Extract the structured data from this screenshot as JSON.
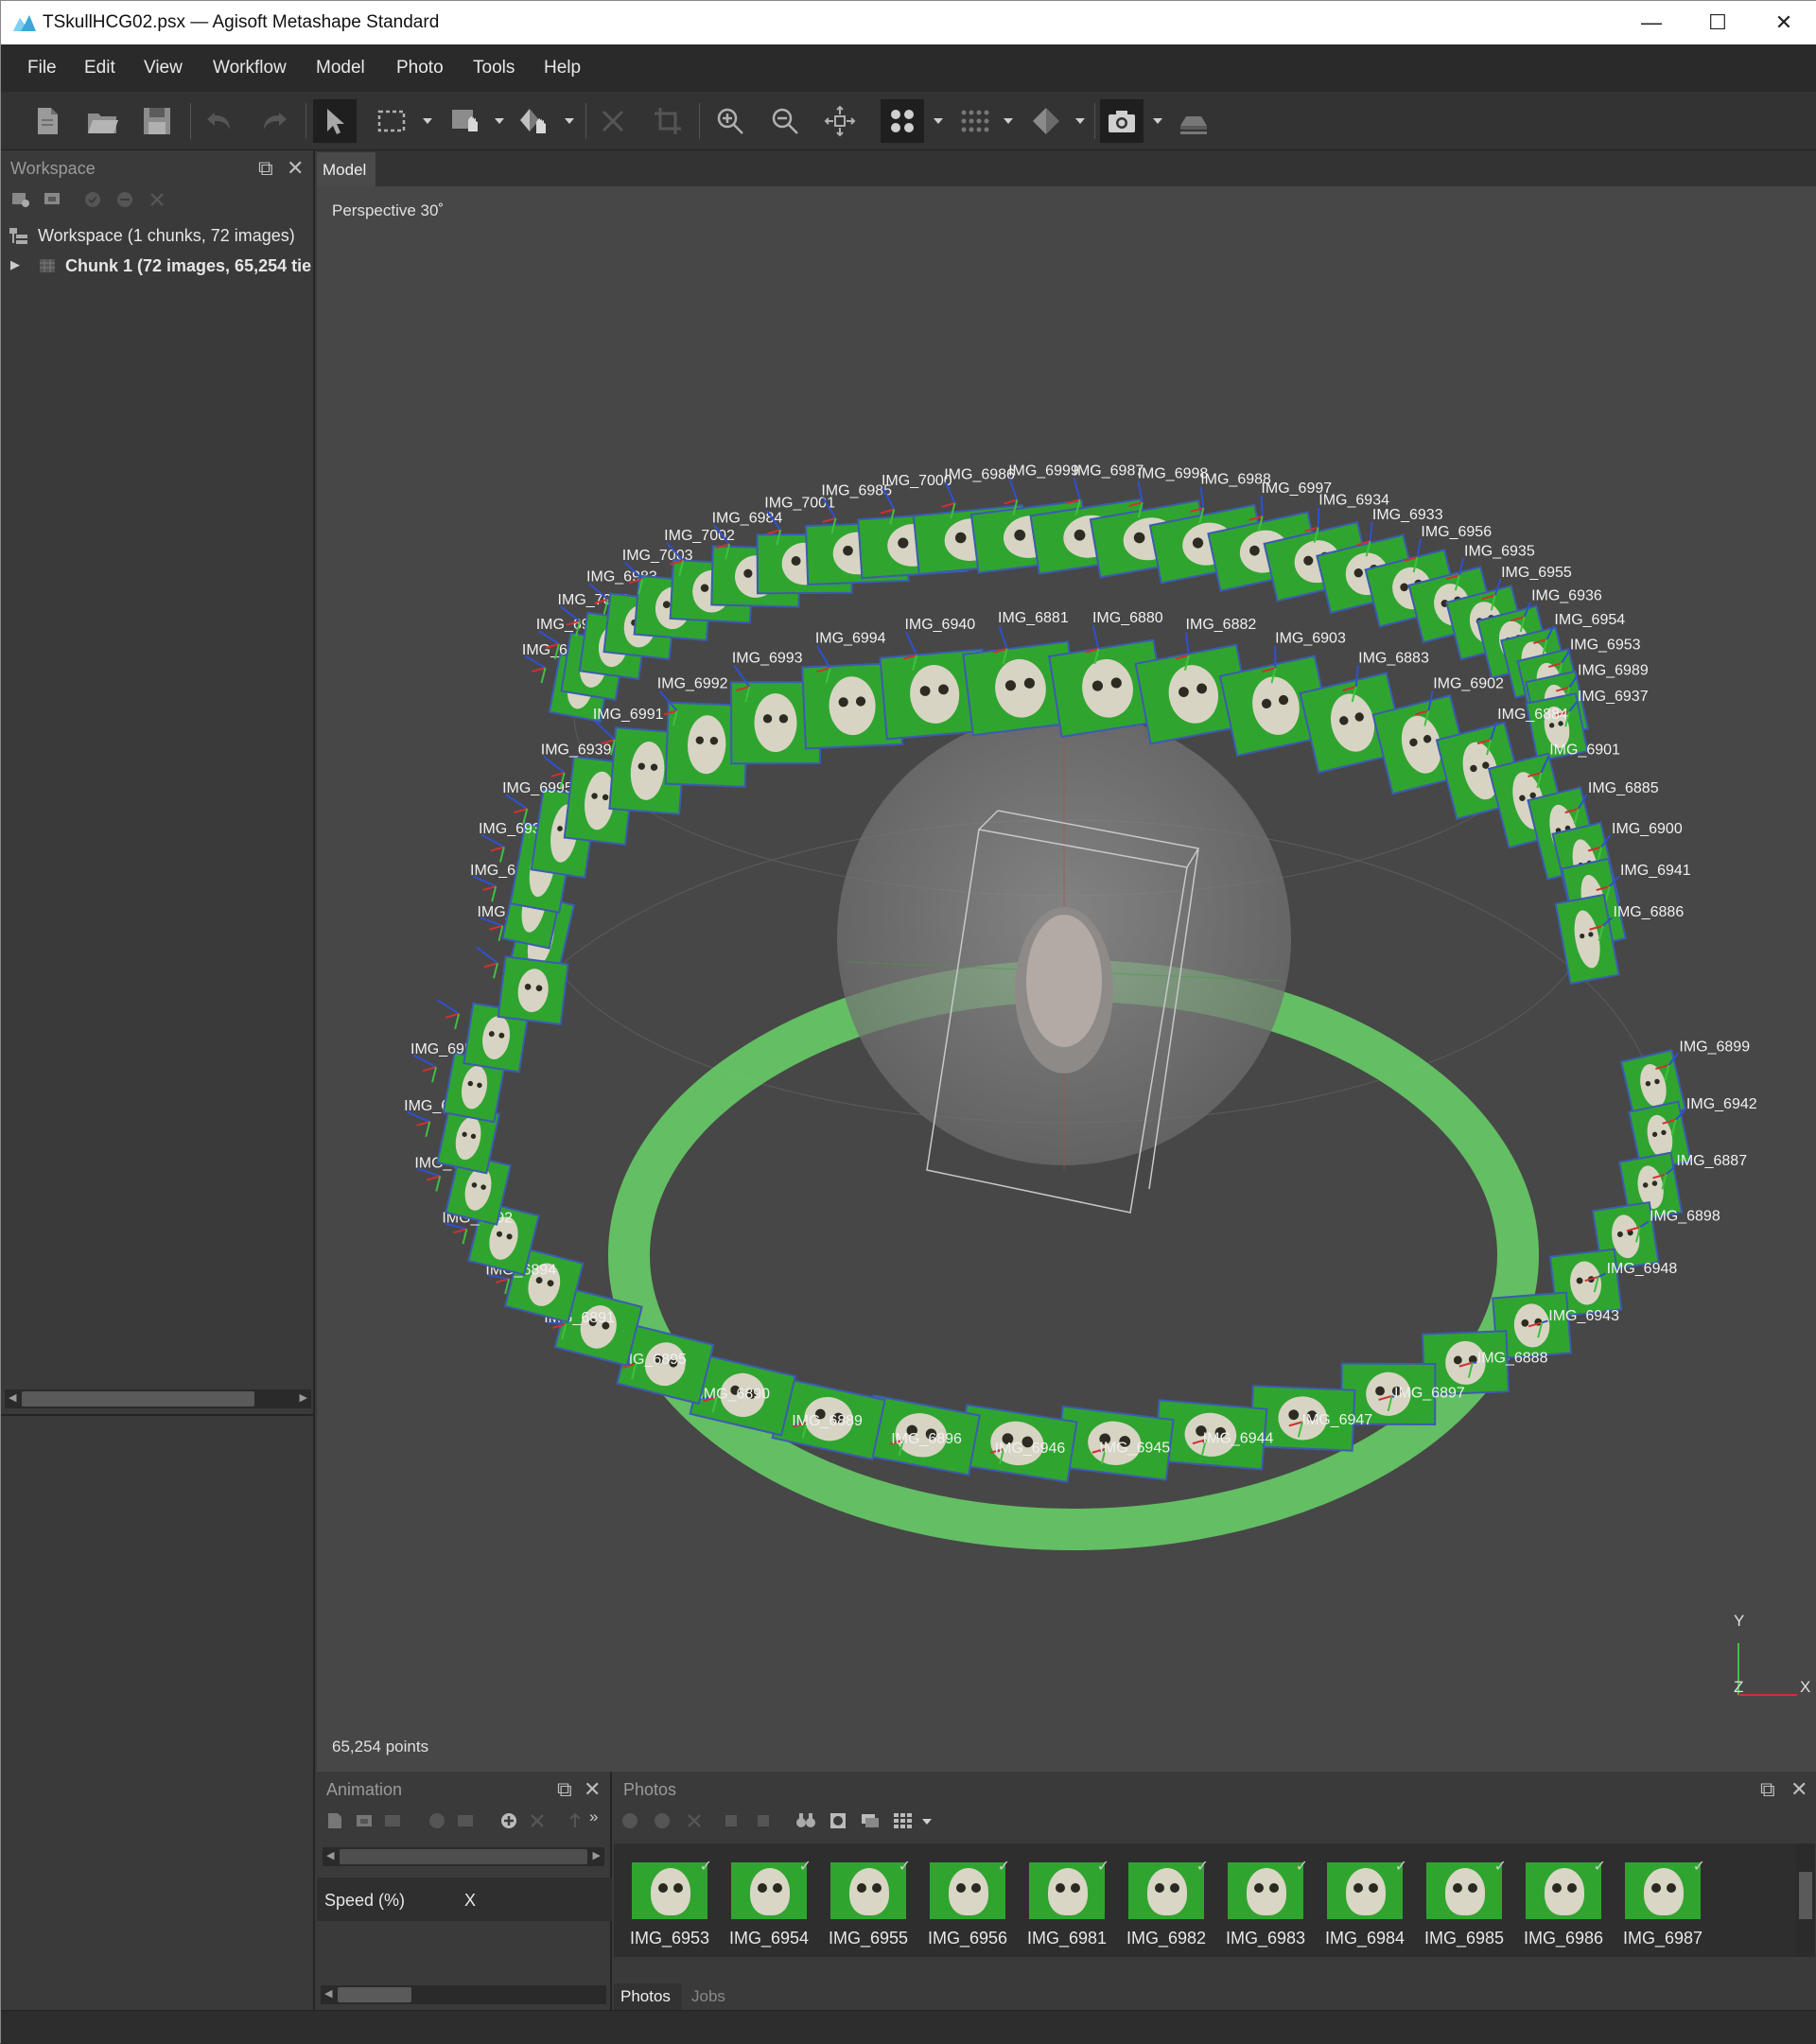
{
  "window": {
    "title": "TSkullHCG02.psx — Agisoft Metashape Standard",
    "minimize": "—",
    "maximize": "☐",
    "close": "✕"
  },
  "menu": [
    "File",
    "Edit",
    "View",
    "Workflow",
    "Model",
    "Photo",
    "Tools",
    "Help"
  ],
  "workspace": {
    "header": "Workspace",
    "root": "Workspace (1 chunks, 72 images)",
    "chunk": "Chunk 1 (72 images, 65,254 tie p"
  },
  "model": {
    "tab": "Model",
    "projection": "Perspective 30˚",
    "points": "65,254 points",
    "axis_y": "Y",
    "axis_z": "Z",
    "axis_x": "X",
    "camera_labels": [
      "IMG_6982",
      "IMG_6981",
      "IMG_7004",
      "IMG_6983",
      "IMG_7003",
      "IMG_7002",
      "IMG_6984",
      "IMG_7001",
      "IMG_6985",
      "IMG_7000",
      "IMG_6986",
      "IMG_6999",
      "IMG_6987",
      "IMG_6998",
      "IMG_6988",
      "IMG_6997",
      "IMG_6934",
      "IMG_6933",
      "IMG_6956",
      "IMG_6935",
      "IMG_6955",
      "IMG_6936",
      "IMG_6954",
      "IMG_6953",
      "IMG_6989",
      "IMG_6937",
      "IMG_6996",
      "IMG_6952",
      "IMG_6938",
      "IMG_6995",
      "IMG_6939",
      "IMG_6991",
      "IMG_6992",
      "IMG_6993",
      "IMG_6994",
      "IMG_6940",
      "IMG_6881",
      "IMG_6880",
      "IMG_6882",
      "IMG_6903",
      "IMG_6883",
      "IMG_6902",
      "IMG_6884",
      "IMG_6901",
      "IMG_6885",
      "IMG_6900",
      "IMG_6941",
      "IMG_6886",
      "IMG_6899",
      "IMG_6942",
      "IMG_6887",
      "IMG_6898",
      "IMG_6948",
      "IMG_6943",
      "IMG_6888",
      "IMG_6897",
      "IMG_6947",
      "IMG_6944",
      "IMG_6945",
      "IMG_6946",
      "IMG_6896",
      "IMG_6889",
      "IMG_6890",
      "IMG_6895",
      "IMG_6891",
      "IMG_6894",
      "IMG_6892",
      "IMG_6893",
      "IMG_6949",
      "IMG_6950"
    ]
  },
  "animation": {
    "header": "Animation",
    "speed_label": "Speed (%)",
    "speed_value": "X"
  },
  "photos": {
    "header": "Photos",
    "items": [
      "IMG_6953",
      "IMG_6954",
      "IMG_6955",
      "IMG_6956",
      "IMG_6981",
      "IMG_6982",
      "IMG_6983",
      "IMG_6984",
      "IMG_6985",
      "IMG_6986",
      "IMG_6987"
    ],
    "tab_photos": "Photos",
    "tab_jobs": "Jobs"
  },
  "colors": {
    "viewport_bg": "#474747",
    "camera_plane": "#2fa52f",
    "camera_border": "#3d5bb0",
    "sphere": "#8a8a8a"
  }
}
